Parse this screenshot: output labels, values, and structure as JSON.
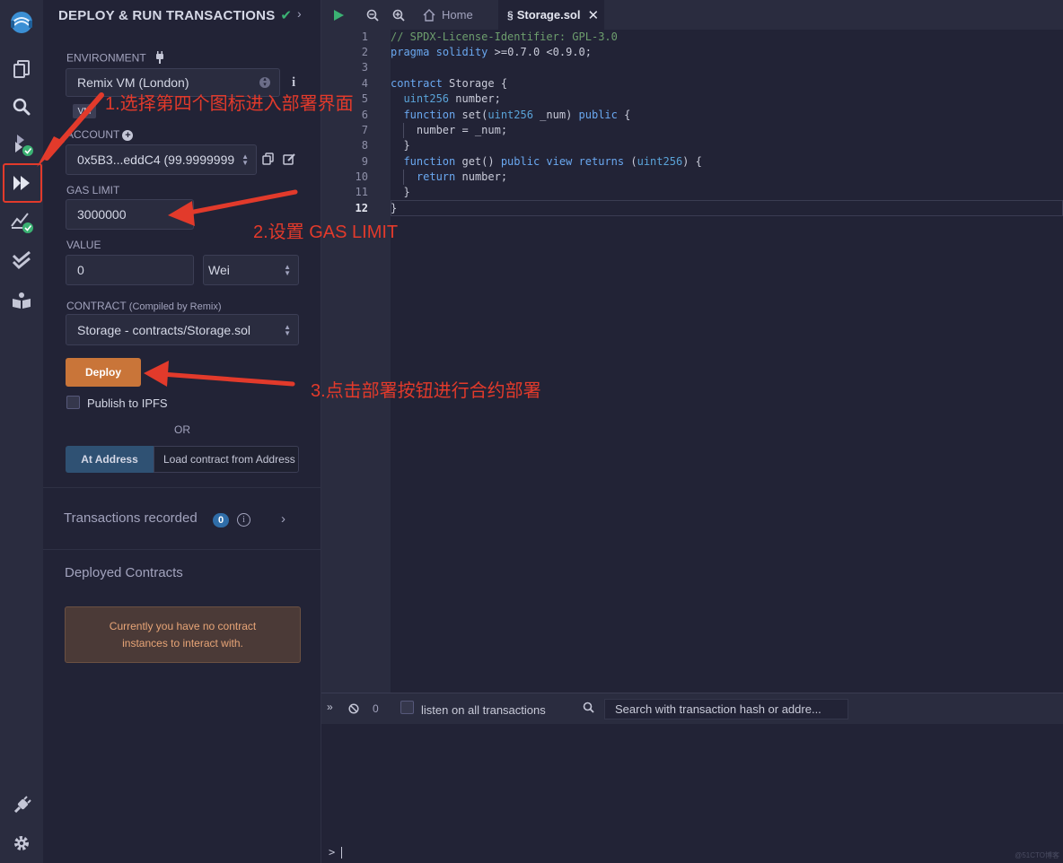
{
  "panel": {
    "title": "DEPLOY & RUN TRANSACTIONS",
    "environment": {
      "label": "ENVIRONMENT",
      "value": "Remix VM (London)",
      "vm_badge": "VM"
    },
    "account": {
      "label": "ACCOUNT",
      "value": "0x5B3...eddC4 (99.9999999"
    },
    "gas_limit": {
      "label": "GAS LIMIT",
      "value": "3000000"
    },
    "value": {
      "label": "VALUE",
      "amount": "0",
      "unit": "Wei"
    },
    "contract": {
      "label": "CONTRACT",
      "label_note": "(Compiled by Remix)",
      "value": "Storage - contracts/Storage.sol"
    },
    "deploy_label": "Deploy",
    "publish_ipfs_label": "Publish to IPFS",
    "or_label": "OR",
    "at_address_label": "At Address",
    "load_contract_placeholder": "Load contract from Address",
    "transactions_recorded": {
      "label": "Transactions recorded",
      "count": "0"
    },
    "deployed_contracts": {
      "label": "Deployed Contracts",
      "empty_message": "Currently you have no contract instances to interact with."
    }
  },
  "tabs": {
    "home_label": "Home",
    "file_label": "Storage.sol"
  },
  "editor": {
    "line_numbers": [
      "1",
      "2",
      "3",
      "4",
      "5",
      "6",
      "7",
      "8",
      "9",
      "10",
      "11",
      "12"
    ],
    "active_line": "12",
    "lines": [
      "// SPDX-License-Identifier: GPL-3.0",
      "pragma solidity >=0.7.0 <0.9.0;",
      "",
      "contract Storage {",
      "  uint256 number;",
      "  function set(uint256 _num) public {",
      "    number = _num;",
      "  }",
      "  function get() public view returns (uint256) {",
      "    return number;",
      "  }",
      "}"
    ]
  },
  "terminal": {
    "pending_count": "0",
    "listen_label": "listen on all transactions",
    "search_placeholder": "Search with transaction hash or address",
    "search_value": "Search with transaction hash or addre...",
    "prompt": ">"
  },
  "annotations": {
    "step1": "1.选择第四个图标进入部署界面",
    "step2": "2.设置 GAS LIMIT",
    "step3": "3.点击部署按钮进行合约部署"
  },
  "watermark": "@51CTO博客",
  "colors": {
    "accent_deploy": "#c97539",
    "annotation_red": "#e23a2b",
    "success_green": "#3bb273",
    "badge_blue": "#2f6da8"
  }
}
